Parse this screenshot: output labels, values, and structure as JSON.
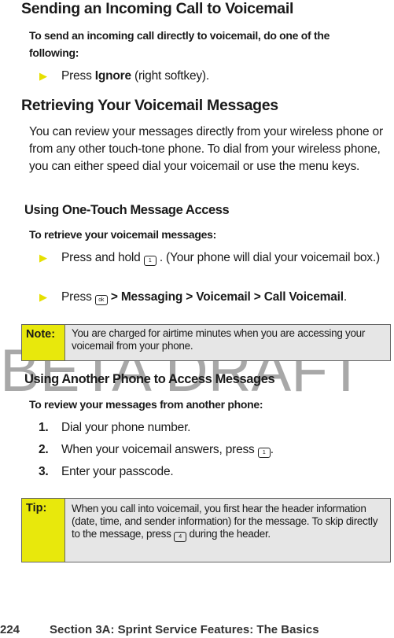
{
  "watermark": "BETA DRAFT",
  "section1": {
    "title": "Sending an Incoming Call to Voicemail",
    "lead": "To send an incoming call directly to voicemail, do one of the following:",
    "bullet": {
      "pre": "Press ",
      "bold": "Ignore",
      "post": " (right softkey)."
    }
  },
  "section2": {
    "title": "Retrieving Your Voicemail Messages",
    "para": "You can review your messages directly from your wireless phone or from any other touch-tone phone. To dial from your wireless phone, you can either speed dial your voicemail or use the menu keys."
  },
  "sub1": {
    "title": "Using One-Touch Message Access",
    "lead": "To retrieve your voicemail messages:",
    "b1": {
      "pre": "Press and hold",
      "post": ". (Your phone will dial your voicemail box.)",
      "icon": "key-1-voicemail-icon"
    },
    "b2": {
      "pre": "Press",
      "sep": ">",
      "m1": "Messaging",
      "m2": "Voicemail",
      "m3": "Call Voicemail",
      "end": ".",
      "icon": "menu-ok-key-icon"
    }
  },
  "note": {
    "label": "Note:",
    "text": "You are charged for airtime minutes when you are accessing your voicemail from your phone."
  },
  "sub2": {
    "title": "Using Another Phone to Access Messages",
    "lead": "To review your messages from another phone:",
    "steps": [
      {
        "num": "1.",
        "text": "Dial your phone number."
      },
      {
        "num": "2.",
        "text": "When your voicemail answers, press",
        "end": "."
      },
      {
        "num": "3.",
        "text": "Enter your passcode."
      }
    ]
  },
  "tip": {
    "label": "Tip:",
    "text1": "When you call into voicemail, you first hear the header information (date, time, and sender information) for the message. To skip directly to the message, press",
    "text2": "during the header."
  },
  "footer": {
    "page": "224",
    "section": "Section 3A: Sprint Service Features: The Basics"
  },
  "colors": {
    "label_bg": "#e8e80c",
    "box_bg": "#e6e6e6",
    "watermark": "#a8a8a8"
  }
}
